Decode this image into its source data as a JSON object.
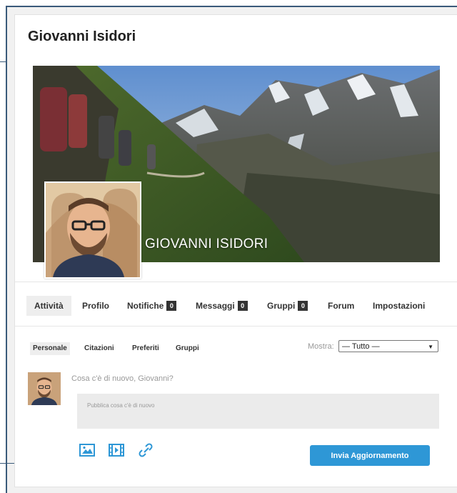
{
  "profile": {
    "title": "Giovanni Isidori",
    "cover_name": "GIOVANNI ISIDORI"
  },
  "nav": {
    "items": [
      {
        "label": "Attività",
        "active": true
      },
      {
        "label": "Profilo"
      },
      {
        "label": "Notifiche",
        "badge": "0"
      },
      {
        "label": "Messaggi",
        "badge": "0"
      },
      {
        "label": "Gruppi",
        "badge": "0"
      },
      {
        "label": "Forum"
      },
      {
        "label": "Impostazioni"
      }
    ]
  },
  "subnav": {
    "items": [
      {
        "label": "Personale",
        "active": true
      },
      {
        "label": "Citazioni"
      },
      {
        "label": "Preferiti"
      },
      {
        "label": "Gruppi"
      }
    ],
    "filter_label": "Mostra:",
    "filter_value": "— Tutto —"
  },
  "post": {
    "prompt": "Cosa c'è di nuovo, Giovanni?",
    "placeholder": "Pubblica cosa c'è di nuovo",
    "submit_label": "Invia Aggiornamento",
    "icons": [
      "image-icon",
      "video-icon",
      "link-icon"
    ]
  },
  "colors": {
    "accent": "#2e97d6",
    "badge": "#333333",
    "frame": "#3a5a7a"
  }
}
